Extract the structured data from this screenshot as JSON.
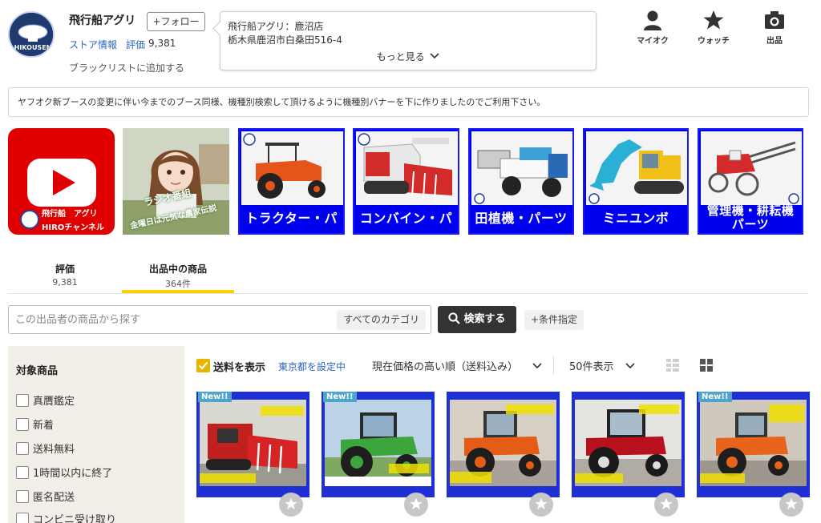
{
  "store": {
    "name": "飛行船アグリ",
    "follow_label": "+フォロー",
    "info_link": "ストア情報",
    "rating_label": "評価",
    "rating_value": "9,381",
    "blacklist": "ブラックリストに追加する",
    "logo_text": "HIKOUSEN"
  },
  "popup": {
    "line1": "飛行船アグリ：鹿沼店",
    "line2": "栃木県鹿沼市白桑田516-4",
    "more": "もっと見る"
  },
  "top_icons": [
    {
      "label": "マイオク",
      "icon": "person-icon"
    },
    {
      "label": "ウォッチ",
      "icon": "star-icon"
    },
    {
      "label": "出品",
      "icon": "camera-icon"
    }
  ],
  "notice": "ヤフオク新ブースの変更に伴い今までのブース同様、機種別検索して頂けるように機種別バナーを下に作りましたのでご利用下さい。",
  "banners": {
    "youtube": {
      "line1": "飛行船　アグリ",
      "line2": "HIROチャンネル"
    },
    "radio": {
      "line1": "ラジオ番組",
      "line2": "金曜日は元気な農家伝説"
    },
    "tractor": "トラクター・パーツ",
    "combine": "コンバイン・パーツ",
    "planter": "田植機・パーツ",
    "excavator": "ミニユンボ",
    "cultivator_line1": "管理機・耕耘機",
    "cultivator_line2": "パーツ"
  },
  "tabs": [
    {
      "title": "評価",
      "count": "9,381"
    },
    {
      "title": "出品中の商品",
      "count": "364件"
    }
  ],
  "search": {
    "placeholder": "この出品者の商品から探す",
    "category": "すべてのカテゴリ",
    "button": "検索する",
    "conditions": "+条件指定"
  },
  "sidebar": {
    "title": "対象商品",
    "filters": [
      "真贋鑑定",
      "新着",
      "送料無料",
      "1時間以内に終了",
      "匿名配送",
      "コンビニ受け取り"
    ]
  },
  "toolbar": {
    "shipping_label": "送料を表示",
    "area": "東京都を設定中",
    "sort": "現在価格の高い順（送料込み）",
    "per_page": "50件表示"
  },
  "products": [
    {
      "badge": "New!!",
      "kind": "combine"
    },
    {
      "badge": "New!!",
      "kind": "green-tractor"
    },
    {
      "badge": "",
      "kind": "orange-tractor"
    },
    {
      "badge": "",
      "kind": "red-tractor"
    },
    {
      "badge": "New!!",
      "kind": "orange-tractor-2"
    }
  ],
  "colors": {
    "accent_yellow": "#ffcf00",
    "banner_blue": "#0000f0",
    "link_blue": "#2a65c4",
    "youtube_red": "#e00000"
  }
}
